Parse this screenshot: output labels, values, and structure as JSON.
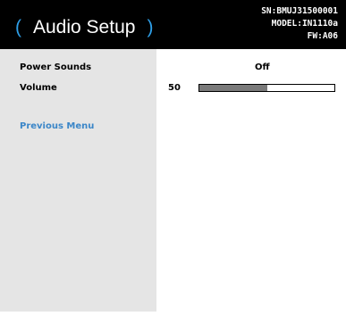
{
  "header": {
    "title": "Audio Setup",
    "paren_open": "(",
    "paren_close": ")",
    "serial": "SN:BMUJ31500001",
    "model": "MODEL:IN1110a",
    "firmware": "FW:A06"
  },
  "menu": {
    "items": [
      {
        "label": "Power Sounds",
        "value": "Off"
      },
      {
        "label": "Volume",
        "value": "50",
        "level_fraction": 0.5
      }
    ],
    "previous_menu_label": "Previous Menu"
  },
  "colors": {
    "header_bg": "#000000",
    "paren_accent": "#2e9fe8",
    "sidebar_bg": "#e5e5e5",
    "link": "#3b86c8",
    "slider_fill": "#7a7a7a"
  }
}
